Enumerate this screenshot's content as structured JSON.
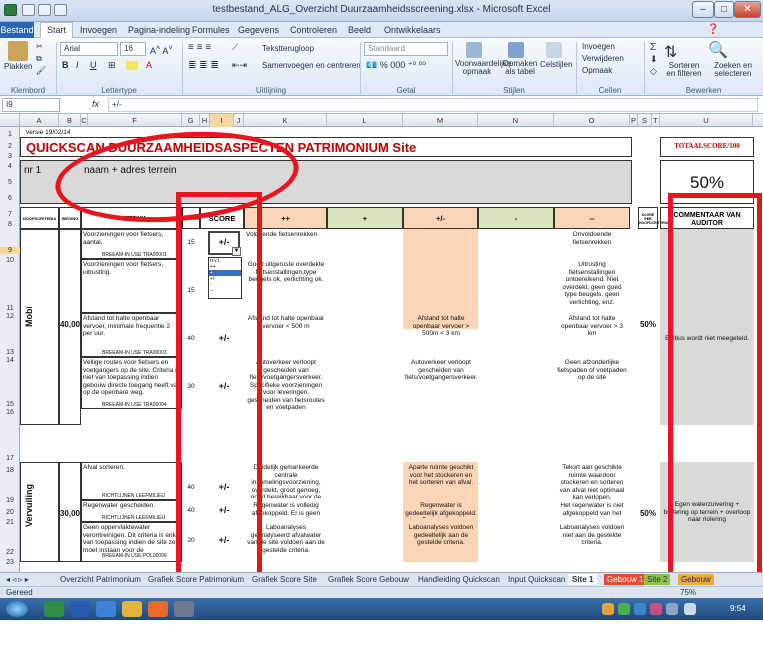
{
  "window": {
    "title": "testbestand_ALG_Overzicht Duurzaamheidsscreening.xlsx - Microsoft Excel",
    "min": "–",
    "max": "□",
    "close": "✕"
  },
  "ribbon_tabs": [
    "Bestand",
    "Start",
    "Invoegen",
    "Pagina-indeling",
    "Formules",
    "Gegevens",
    "Controleren",
    "Beeld",
    "Ontwikkelaars"
  ],
  "ribbon": {
    "paste": "Plakken",
    "font_name": "Arial",
    "font_size": "16",
    "wrap": "Tekstterugloop",
    "merge": "Samenvoegen en centreren",
    "number_format": "Standaard",
    "cond_format": "Voorwaardelijke opmaak",
    "as_table": "Opmaken als tabel",
    "cell_styles": "Celstijlen",
    "insert": "Invoegen",
    "delete": "Verwijderen",
    "format": "Opmaak",
    "sort": "Sorteren en filteren",
    "find": "Zoeken en selecteren",
    "groups": [
      "Klembord",
      "Lettertype",
      "Uitlijning",
      "Getal",
      "Stijlen",
      "Cellen",
      "Bewerken"
    ]
  },
  "formula_bar": {
    "cell": "I9",
    "fx": "fx",
    "value": "+/-"
  },
  "columns": [
    "A",
    "B",
    "C",
    "F",
    "G",
    "H",
    "I",
    "J",
    "K",
    "L",
    "M",
    "N",
    "O",
    "P",
    "S",
    "T",
    "U"
  ],
  "rows": [
    "1",
    "2",
    "3",
    "4",
    "5",
    "6",
    "7",
    "8",
    "9",
    "10",
    "11",
    "12",
    "13",
    "14",
    "15",
    "16",
    "17",
    "18",
    "19",
    "20",
    "21",
    "22",
    "23"
  ],
  "sheet": {
    "version": "versie 19/02/14",
    "title": "QUICKSCAN DUURZAAMHEIDSASPECTEN PATRIMONIUM Site",
    "total_label": "TOTAALSCORE/100",
    "nr": "nr 1",
    "name_addr": "naam + adres terrein",
    "total_pct": "50%",
    "headers": {
      "cat": "HOOFDCRITERIA",
      "weight": "WEGING",
      "crit": "CRITERIUM",
      "g": "GEWICHT",
      "score": "SCORE",
      "pp": "++",
      "p": "+",
      "pm": "+/-",
      "m": "-",
      "mm": "--",
      "sum": "SCORE PER HOOFDCRITERIUM",
      "comment": "COMMENTAAR VAN AUDITOR"
    },
    "mobility": {
      "label": "Mobiliteit",
      "weight": "40,00",
      "pct": "50%",
      "comment": "Belbus wordt niet meegeteld.",
      "items": [
        {
          "crit": "Voorzieningen voor fietsers, aantal.",
          "ref": "BREEAM-IN USE TRA00001",
          "w": "15",
          "score": "+/-",
          "pp": "Voldoende fietsenrekken",
          "pm": "",
          "mm": "Onvoldoende fietsenrekken"
        },
        {
          "crit": "Voorzieningen voor fietsers, uitrusting.",
          "ref": "",
          "w": "15",
          "score": "",
          "pp": "Goed uitgeruste overdekte fietsenstallingen,type beugels ok, verlichting ok.",
          "pm": "",
          "mm": "Uitrusting fietsenstallingen ontoereikend. Niet overdekt, geen goed type beugels, geen verlichting, enz."
        },
        {
          "crit": "Afstand tot halte openbaar vervoer, minimale frequentie 2 per uur.",
          "ref": "BREEAM-IN USE TRA00003",
          "w": "40",
          "score": "+/-",
          "pp": "Afstand tot halte openbaar vervoer < 500 m",
          "pm": "Afstand tot halte openbaar vervoer > 500m < 3 km",
          "mm": "Afstand tot halte openbaar vervoer > 3 km"
        },
        {
          "crit": "Veilige routes voor fietsers en voetgangers op de site. Criteria is niet van toepassing indien gebouw directe toegang heeft van op de openbare weg.",
          "ref": "BREEAM-IN USE TRA00004",
          "w": "30",
          "score": "+/-",
          "pp": "Autoverkeer verloopt gescheiden van fiets/voetgangersverkeer. Specifieke voorzieningen voor leveringen, gescheiden van fietsroutes en voetpaden",
          "pm": "Autoverkeer verloopt gescheiden van fiets/voetgangersverkeer.",
          "mm": "Geen afzonderlijke fietspaden of voetpaden op de site"
        }
      ]
    },
    "waste": {
      "label": "Vervuiling",
      "weight": "30,00",
      "pct": "50%",
      "comment": "Egen waterzuivering + buffering op terrein + overloop naar riolering",
      "items": [
        {
          "crit": "Afval sorteren.",
          "ref": "RICHTLIJNEN LEEFMILIEU",
          "w": "40",
          "score": "+/-",
          "pp": "Duidelijk gemarkeerde centrale inzamelingsvoorziening, overdekt, groot genoeg, goed bereikbaar voor de",
          "pm": "Aparte ruimte geschikt voor het stockeren en het sorteren van afval.",
          "mm": "Tekort aan geschikte ruimte waardoor stockeren en sorteren van afval niet optimaal kan verlopen."
        },
        {
          "crit": "Regenwater gescheiden.",
          "ref": "RICHTLIJNEN LEEFMILIEU",
          "w": "40",
          "score": "+/-",
          "pp": "Regenwater is volledig afgekoppeld. Er is geen",
          "pm": "Regenwater is gedeeltelijk afgekoppeld. Een deel van",
          "mm": "Het regenwater is niet afgekoppeld van het"
        },
        {
          "crit": "Geen oppervlaktewater verontreinigen. Dit criteria is enkel van toepassing indien de site zelf moet instaan voor de",
          "ref": "BREEAM-IN USE POL00006",
          "w": "20",
          "score": "+/-",
          "pp": "Laboanalyses geanalyseerd afvalwater van de site voldoen aan de gestelde criteria.",
          "pm": "Laboanalyses voldoen gedeeltelijk aan de gestelde criteria.",
          "mm": "Laboanalyses voldoen niet aan de gestelde criteria."
        }
      ]
    },
    "dropdown_options": [
      "n.v.t.",
      "++",
      "+",
      "+/-",
      "-",
      "--"
    ]
  },
  "sheet_tabs": [
    "Overzicht Patrimonium",
    "Grafiek Score Patrimonium",
    "Grafiek Score Site",
    "Grafiek Score Gebouw",
    "Handleiding Quickscan",
    "Input Quickscan",
    "Site 1",
    "Gebouw 1",
    "Site 2",
    "Gebouw"
  ],
  "status": {
    "ready": "Gereed",
    "zoom": "75%"
  },
  "taskbar": {
    "time": "9:54"
  },
  "colors": {
    "accent_red": "#e8141f",
    "title_red": "#c00000",
    "orange": "#fbd5b5",
    "green": "#d7e4bd"
  }
}
